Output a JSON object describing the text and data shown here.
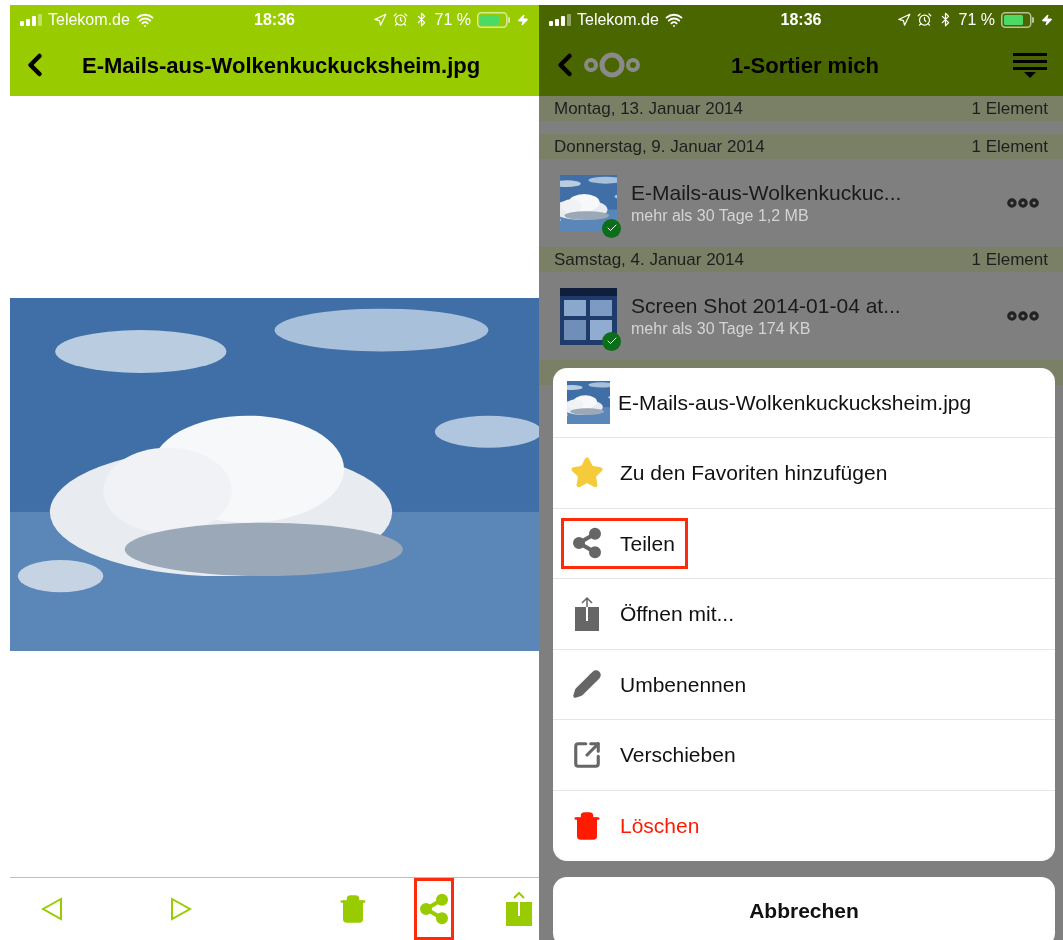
{
  "left_screen": {
    "status_bar": {
      "carrier": "Telekom.de",
      "time": "18:36",
      "battery": "71 %"
    },
    "title": "E-Mails-aus-Wolkenkuckucksheim.jpg",
    "toolbar": [
      {
        "kind": "previous",
        "highlighted": false
      },
      {
        "kind": "next",
        "highlighted": false
      },
      {
        "kind": "delete",
        "highlighted": false
      },
      {
        "kind": "share",
        "highlighted": true
      },
      {
        "kind": "open",
        "highlighted": false
      }
    ]
  },
  "right_screen": {
    "status_bar": {
      "carrier": "Telekom.de",
      "time": "18:36",
      "battery": "71 %"
    },
    "title": "1-Sortier mich",
    "sections": [
      {
        "date": "Montag, 13. Januar 2014",
        "count": "1 Element"
      },
      {
        "date": "Donnerstag, 9. Januar 2014",
        "count": "1 Element",
        "file": {
          "name": "E-Mails-aus-Wolkenkuckuc...",
          "meta": "mehr als 30 Tage 1,2 MB",
          "synced": true
        }
      },
      {
        "date": "Samstag, 4. Januar 2014",
        "count": "1 Element",
        "file": {
          "name": "Screen Shot 2014-01-04 at...",
          "meta": "mehr als 30 Tage 174 KB",
          "synced": true
        }
      }
    ],
    "action_sheet": {
      "file_name": "E-Mails-aus-Wolkenkuckucksheim.jpg",
      "actions": [
        {
          "kind": "favorite",
          "label": "Zu den Favoriten hinzufügen",
          "highlighted": false,
          "destructive": false
        },
        {
          "kind": "share",
          "label": "Teilen",
          "highlighted": true,
          "destructive": false
        },
        {
          "kind": "open",
          "label": "Öffnen mit...",
          "highlighted": false,
          "destructive": false
        },
        {
          "kind": "rename",
          "label": "Umbenennen",
          "highlighted": false,
          "destructive": false
        },
        {
          "kind": "move",
          "label": "Verschieben",
          "highlighted": false,
          "destructive": false
        },
        {
          "kind": "delete",
          "label": "Löschen",
          "highlighted": false,
          "destructive": true
        }
      ],
      "cancel": "Abbrechen"
    }
  }
}
